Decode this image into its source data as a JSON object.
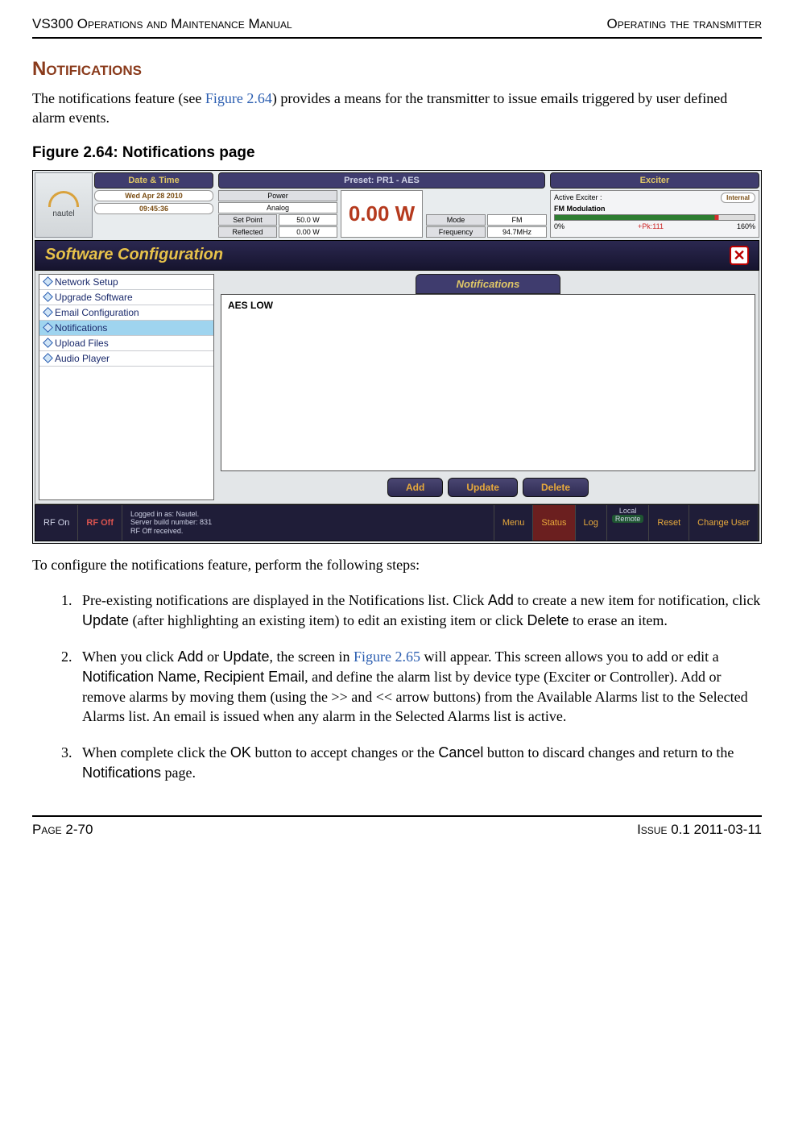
{
  "header": {
    "left": "VS300 Operations and Maintenance Manual",
    "right": "Operating the transmitter"
  },
  "section_title": "Notifications",
  "intro_pre": "The notifications feature (see ",
  "intro_link": "Figure 2.64",
  "intro_post": ") provides a means for the transmitter to issue emails triggered by user defined alarm events.",
  "fig_caption": "Figure 2.64: Notifications page",
  "screenshot": {
    "logo": "nautel",
    "date_time_label": "Date & Time",
    "date_val": "Wed Apr 28 2010",
    "time_val": "09:45:36",
    "preset_bar": "Preset: PR1 - AES",
    "exciter_bar": "Exciter",
    "power_label": "Power",
    "analog_label": "Analog",
    "big_reading": "0.00 W",
    "setpoint_label": "Set Point",
    "setpoint_val": "50.0 W",
    "mode_label": "Mode",
    "mode_val": "FM",
    "reflected_label": "Reflected",
    "reflected_val": "0.00 W",
    "freq_label": "Frequency",
    "freq_val": "94.7MHz",
    "active_exciter_label": "Active Exciter :",
    "active_exciter_val": "Internal",
    "fm_mod_label": "FM Modulation",
    "meter_left": "0%",
    "meter_pk": "+Pk:111",
    "meter_right": "160%",
    "soft_config": "Software Configuration",
    "side_items": [
      "Network Setup",
      "Upgrade Software",
      "Email Configuration",
      "Notifications",
      "Upload Files",
      "Audio Player"
    ],
    "notif_title": "Notifications",
    "notif_items": [
      "AES LOW"
    ],
    "btn_add": "Add",
    "btn_update": "Update",
    "btn_delete": "Delete",
    "sb_rfon": "RF On",
    "sb_rfoff": "RF Off",
    "sb_info_l1": "Logged in as:    Nautel.",
    "sb_info_l2": "Server build number: 831",
    "sb_info_l3": "RF Off received.",
    "sb_menu": "Menu",
    "sb_status": "Status",
    "sb_log": "Log",
    "sb_local": "Local",
    "sb_remote": "Remote",
    "sb_reset": "Reset",
    "sb_change": "Change User"
  },
  "config_intro": "To configure the notifications feature, perform the following steps:",
  "steps": {
    "s1_a": "Pre-existing notifications are displayed in the Notifications list. Click ",
    "s1_add": "Add",
    "s1_b": " to create a new item for notification, click ",
    "s1_update": "Update",
    "s1_c": " (after highlighting an existing item) to edit an existing item or click ",
    "s1_delete": "Delete",
    "s1_d": " to erase an item.",
    "s2_a": "When you click ",
    "s2_add": "Add",
    "s2_b": " or ",
    "s2_update": "Update",
    "s2_c": ", the screen in ",
    "s2_link": "Figure 2.65",
    "s2_d": " will appear. This screen allows you to add or edit a ",
    "s2_nn": "Notification Name",
    "s2_e": ", ",
    "s2_re": "Recipient Email",
    "s2_f": ", and define the alarm list by device type (Exciter or Controller). Add or remove alarms by moving them (using the >> and << arrow buttons) from the Available Alarms list to the Selected Alarms list. An email is issued when any alarm in the Selected Alarms list is active.",
    "s3_a": "When complete click the ",
    "s3_ok": "OK",
    "s3_b": " button to accept changes or the ",
    "s3_cancel": "Cancel",
    "s3_c": " button to discard changes and return to the ",
    "s3_notif": "Notifications",
    "s3_d": " page."
  },
  "footer": {
    "left": "Page 2-70",
    "right": "Issue 0.1  2011-03-11"
  }
}
